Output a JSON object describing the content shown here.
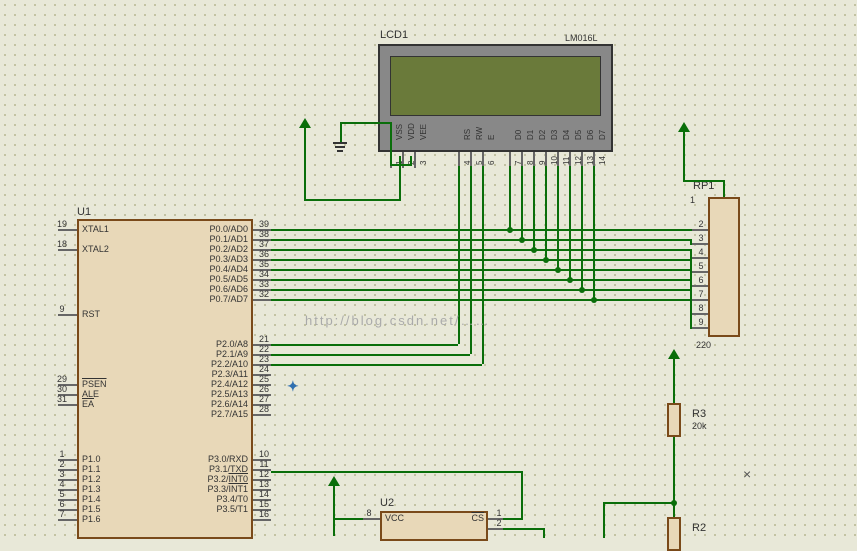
{
  "lcd": {
    "ref": "LCD1",
    "part": "LM016L",
    "pins": [
      {
        "n": "1",
        "name": "VSS"
      },
      {
        "n": "2",
        "name": "VDD"
      },
      {
        "n": "3",
        "name": "VEE"
      },
      {
        "n": "4",
        "name": "RS"
      },
      {
        "n": "5",
        "name": "RW"
      },
      {
        "n": "6",
        "name": "E"
      },
      {
        "n": "7",
        "name": "D0"
      },
      {
        "n": "8",
        "name": "D1"
      },
      {
        "n": "9",
        "name": "D2"
      },
      {
        "n": "10",
        "name": "D3"
      },
      {
        "n": "11",
        "name": "D4"
      },
      {
        "n": "12",
        "name": "D5"
      },
      {
        "n": "13",
        "name": "D6"
      },
      {
        "n": "14",
        "name": "D7"
      }
    ]
  },
  "u1": {
    "ref": "U1",
    "left_pins": [
      {
        "n": "19",
        "name": "XTAL1"
      },
      {
        "n": "18",
        "name": "XTAL2"
      },
      {
        "n": "9",
        "name": "RST"
      },
      {
        "n": "29",
        "name": "PSEN",
        "ov": true
      },
      {
        "n": "30",
        "name": "ALE"
      },
      {
        "n": "31",
        "name": "EA",
        "ov": true
      },
      {
        "n": "1",
        "name": "P1.0"
      },
      {
        "n": "2",
        "name": "P1.1"
      },
      {
        "n": "3",
        "name": "P1.2"
      },
      {
        "n": "4",
        "name": "P1.3"
      },
      {
        "n": "5",
        "name": "P1.4"
      },
      {
        "n": "6",
        "name": "P1.5"
      },
      {
        "n": "7",
        "name": "P1.6"
      }
    ],
    "right_pins": [
      {
        "n": "39",
        "name": "P0.0/AD0"
      },
      {
        "n": "38",
        "name": "P0.1/AD1"
      },
      {
        "n": "37",
        "name": "P0.2/AD2"
      },
      {
        "n": "36",
        "name": "P0.3/AD3"
      },
      {
        "n": "35",
        "name": "P0.4/AD4"
      },
      {
        "n": "34",
        "name": "P0.5/AD5"
      },
      {
        "n": "33",
        "name": "P0.6/AD6"
      },
      {
        "n": "32",
        "name": "P0.7/AD7"
      },
      {
        "n": "21",
        "name": "P2.0/A8"
      },
      {
        "n": "22",
        "name": "P2.1/A9"
      },
      {
        "n": "23",
        "name": "P2.2/A10"
      },
      {
        "n": "24",
        "name": "P2.3/A11"
      },
      {
        "n": "25",
        "name": "P2.4/A12"
      },
      {
        "n": "26",
        "name": "P2.5/A13"
      },
      {
        "n": "27",
        "name": "P2.6/A14"
      },
      {
        "n": "28",
        "name": "P2.7/A15"
      },
      {
        "n": "10",
        "name": "P3.0/RXD"
      },
      {
        "n": "11",
        "name": "P3.1/TXD"
      },
      {
        "n": "12",
        "name": "P3.2/INT0",
        "ov_part": "INT0"
      },
      {
        "n": "13",
        "name": "P3.3/INT1",
        "ov_part": "INT1"
      },
      {
        "n": "14",
        "name": "P3.4/T0"
      },
      {
        "n": "15",
        "name": "P3.5/T1"
      },
      {
        "n": "16",
        "name": ""
      }
    ]
  },
  "u2": {
    "ref": "U2",
    "left_pins": [
      {
        "n": "8",
        "name": "VCC"
      }
    ],
    "right_pins": [
      {
        "n": "1",
        "name": "CS",
        "ov": true
      },
      {
        "n": "2",
        "name": ""
      }
    ]
  },
  "rp1": {
    "ref": "RP1",
    "value": "220",
    "top_pin": "1",
    "pins": [
      "2",
      "3",
      "4",
      "5",
      "6",
      "7",
      "8",
      "9"
    ]
  },
  "r3": {
    "ref": "R3",
    "value": "20k"
  },
  "r2": {
    "ref": "R2"
  },
  "watermark": "http://blog.csdn.net/……"
}
